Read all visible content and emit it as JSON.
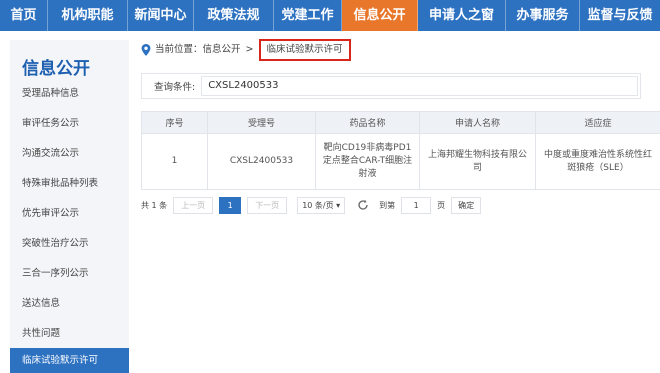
{
  "nav": {
    "items": [
      {
        "label": "首页"
      },
      {
        "label": "机构职能"
      },
      {
        "label": "新闻中心"
      },
      {
        "label": "政策法规"
      },
      {
        "label": "党建工作"
      },
      {
        "label": "信息公开",
        "active": true
      },
      {
        "label": "申请人之窗"
      },
      {
        "label": "办事服务"
      },
      {
        "label": "监督与反馈"
      }
    ]
  },
  "sidebar": {
    "title": "信息公开",
    "items": [
      {
        "label": "受理品种信息"
      },
      {
        "label": "审评任务公示"
      },
      {
        "label": "沟通交流公示"
      },
      {
        "label": "特殊审批品种列表"
      },
      {
        "label": "优先审评公示"
      },
      {
        "label": "突破性治疗公示"
      },
      {
        "label": "三合一序列公示"
      },
      {
        "label": "送达信息"
      },
      {
        "label": "共性问题"
      },
      {
        "label": "临床试验默示许可",
        "active": true
      }
    ]
  },
  "breadcrumb": {
    "prefix": "当前位置：",
    "parent": "信息公开",
    "sep": ">",
    "current": "临床试验默示许可"
  },
  "query": {
    "label": "查询条件:",
    "value": "CXSL2400533"
  },
  "table": {
    "headers": [
      "序号",
      "受理号",
      "药品名称",
      "申请人名称",
      "适应症"
    ],
    "rows": [
      [
        "1",
        "CXSL2400533",
        "靶向CD19非病毒PD1定点整合CAR-T细胞注射液",
        "上海邦耀生物科技有限公司",
        "中度或重度难治性系统性红斑狼疮（SLE）"
      ]
    ]
  },
  "pager": {
    "total": "共 1 条",
    "prev": "上一页",
    "page": "1",
    "next": "下一页",
    "page_size": "10 条/页 ▾",
    "goto": "到第",
    "goto_value": "1",
    "page_unit": "页",
    "confirm": "确定"
  },
  "colors": {
    "nav_bg": "#2d71c1",
    "nav_active": "#e8772b",
    "highlight_border": "#d9261c"
  }
}
